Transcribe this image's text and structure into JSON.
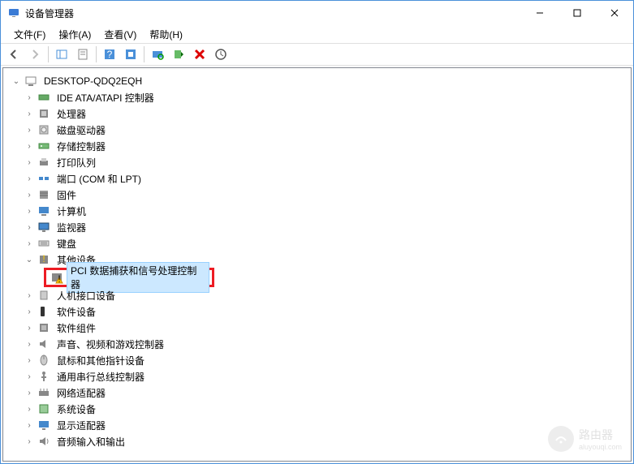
{
  "window": {
    "title": "设备管理器",
    "min": "—",
    "max": "☐",
    "close": "✕"
  },
  "menu": {
    "file": "文件(F)",
    "action": "操作(A)",
    "view": "查看(V)",
    "help": "帮助(H)"
  },
  "tree": {
    "root": "DESKTOP-QDQ2EQH",
    "items": [
      {
        "label": "IDE ATA/ATAPI 控制器",
        "icon": "controller"
      },
      {
        "label": "处理器",
        "icon": "cpu"
      },
      {
        "label": "磁盘驱动器",
        "icon": "disk"
      },
      {
        "label": "存储控制器",
        "icon": "storage"
      },
      {
        "label": "打印队列",
        "icon": "printer"
      },
      {
        "label": "端口 (COM 和 LPT)",
        "icon": "port"
      },
      {
        "label": "固件",
        "icon": "firmware"
      },
      {
        "label": "计算机",
        "icon": "computer"
      },
      {
        "label": "监视器",
        "icon": "monitor"
      },
      {
        "label": "键盘",
        "icon": "keyboard"
      },
      {
        "label": "其他设备",
        "icon": "other",
        "expanded": true
      },
      {
        "label": "人机接口设备",
        "icon": "hid"
      },
      {
        "label": "软件设备",
        "icon": "sw"
      },
      {
        "label": "软件组件",
        "icon": "swc"
      },
      {
        "label": "声音、视频和游戏控制器",
        "icon": "audio"
      },
      {
        "label": "鼠标和其他指针设备",
        "icon": "mouse"
      },
      {
        "label": "通用串行总线控制器",
        "icon": "usb"
      },
      {
        "label": "网络适配器",
        "icon": "network"
      },
      {
        "label": "系统设备",
        "icon": "system"
      },
      {
        "label": "显示适配器",
        "icon": "display"
      },
      {
        "label": "音频输入和输出",
        "icon": "audioio"
      }
    ],
    "other_child": "PCI 数据捕获和信号处理控制器"
  },
  "watermark": {
    "title": "路由器",
    "sub": "aluyouqi.com"
  }
}
